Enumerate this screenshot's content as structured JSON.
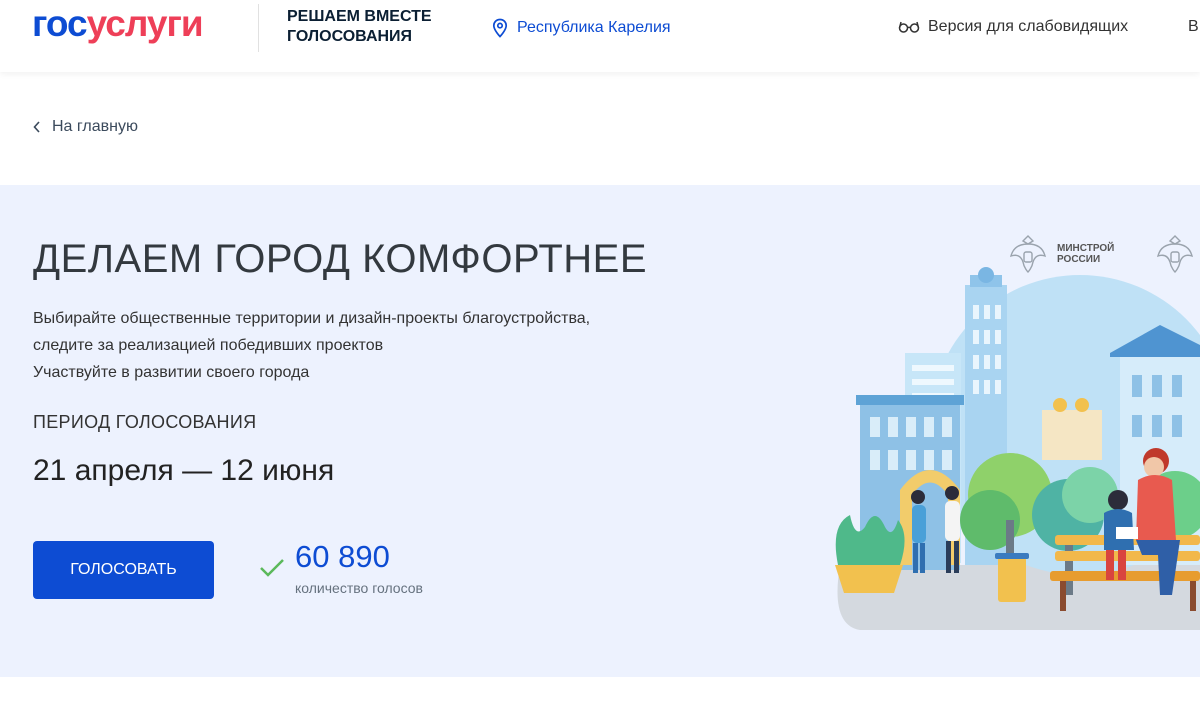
{
  "header": {
    "logo_part1": "гос",
    "logo_part2": "услуги",
    "project_title": "Решаем вместе голосования",
    "region": "Республика Карелия",
    "region_icon": "location-pin-icon",
    "a11y_label": "Версия для слабовидящих",
    "a11y_icon": "glasses-icon",
    "cut_text": "В"
  },
  "breadcrumb": {
    "back_label": "На главную",
    "back_icon": "chevron-left-icon"
  },
  "banner": {
    "title": "ДЕЛАЕМ ГОРОД КОМФОРТНЕЕ",
    "description_lines": [
      "Выбирайте общественные территории и дизайн-проекты благоустройства,",
      "следите за реализацией победивших проектов",
      "Участвуйте в развитии своего города"
    ],
    "period_label": "ПЕРИОД ГОЛОСОВАНИЯ",
    "period_value": "21 апреля — 12 июня",
    "vote_button_label": "ГОЛОСОВАТЬ",
    "vote_count": "60 890",
    "vote_count_label": "количество голосов",
    "ministry_label": "МИНСТРОЙ РОССИИ"
  },
  "colors": {
    "brand_blue": "#0d4cd3",
    "brand_red": "#ee3f58",
    "banner_bg": "#edf2fe",
    "check_green": "#5bb95b"
  }
}
